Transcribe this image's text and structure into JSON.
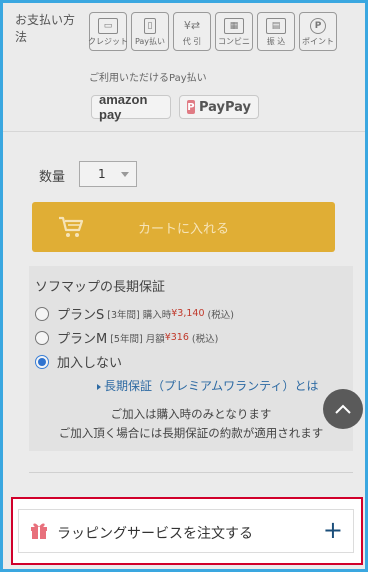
{
  "payment": {
    "label": "お支払い方法",
    "methods": [
      {
        "icon": "credit-card-icon",
        "label": "クレジット"
      },
      {
        "icon": "mobile-pay-icon",
        "label": "Pay払い"
      },
      {
        "icon": "cash-on-delivery-icon",
        "label": "代 引"
      },
      {
        "icon": "convenience-store-icon",
        "label": "コンビニ"
      },
      {
        "icon": "bank-transfer-icon",
        "label": "振 込"
      },
      {
        "icon": "points-icon",
        "label": "ポイント"
      }
    ],
    "available_label": "ご利用いただけるPay払い",
    "brands": [
      {
        "name": "amazon pay"
      },
      {
        "name": "PayPay"
      }
    ]
  },
  "quantity": {
    "label": "数量",
    "value": "1"
  },
  "cart": {
    "button_label": "カートに入れる"
  },
  "warranty": {
    "title": "ソフマップの長期保証",
    "options": [
      {
        "name": "プランS",
        "detail": "[3年間] 購入時",
        "price": "¥3,140",
        "tax": "(税込)",
        "checked": false
      },
      {
        "name": "プランM",
        "detail": "[5年間] 月額",
        "price": "¥316",
        "tax": "(税込)",
        "checked": false
      },
      {
        "name": "加入しない",
        "checked": true
      }
    ],
    "link_text": "長期保証（プレミアムワランティ）とは",
    "note_line1": "ご加入は購入時のみとなります",
    "note_line2": "ご加入頂く場合には長期保証の約款が適用されます"
  },
  "wrapping": {
    "label": "ラッピングサービスを注文する",
    "expand_symbol": "+"
  },
  "colors": {
    "accent_blue": "#3aa7e0",
    "cart_button": "#e0ae35",
    "highlight_border": "#d1002b",
    "price_red": "#c0392b",
    "link_blue": "#2d6aa3"
  }
}
